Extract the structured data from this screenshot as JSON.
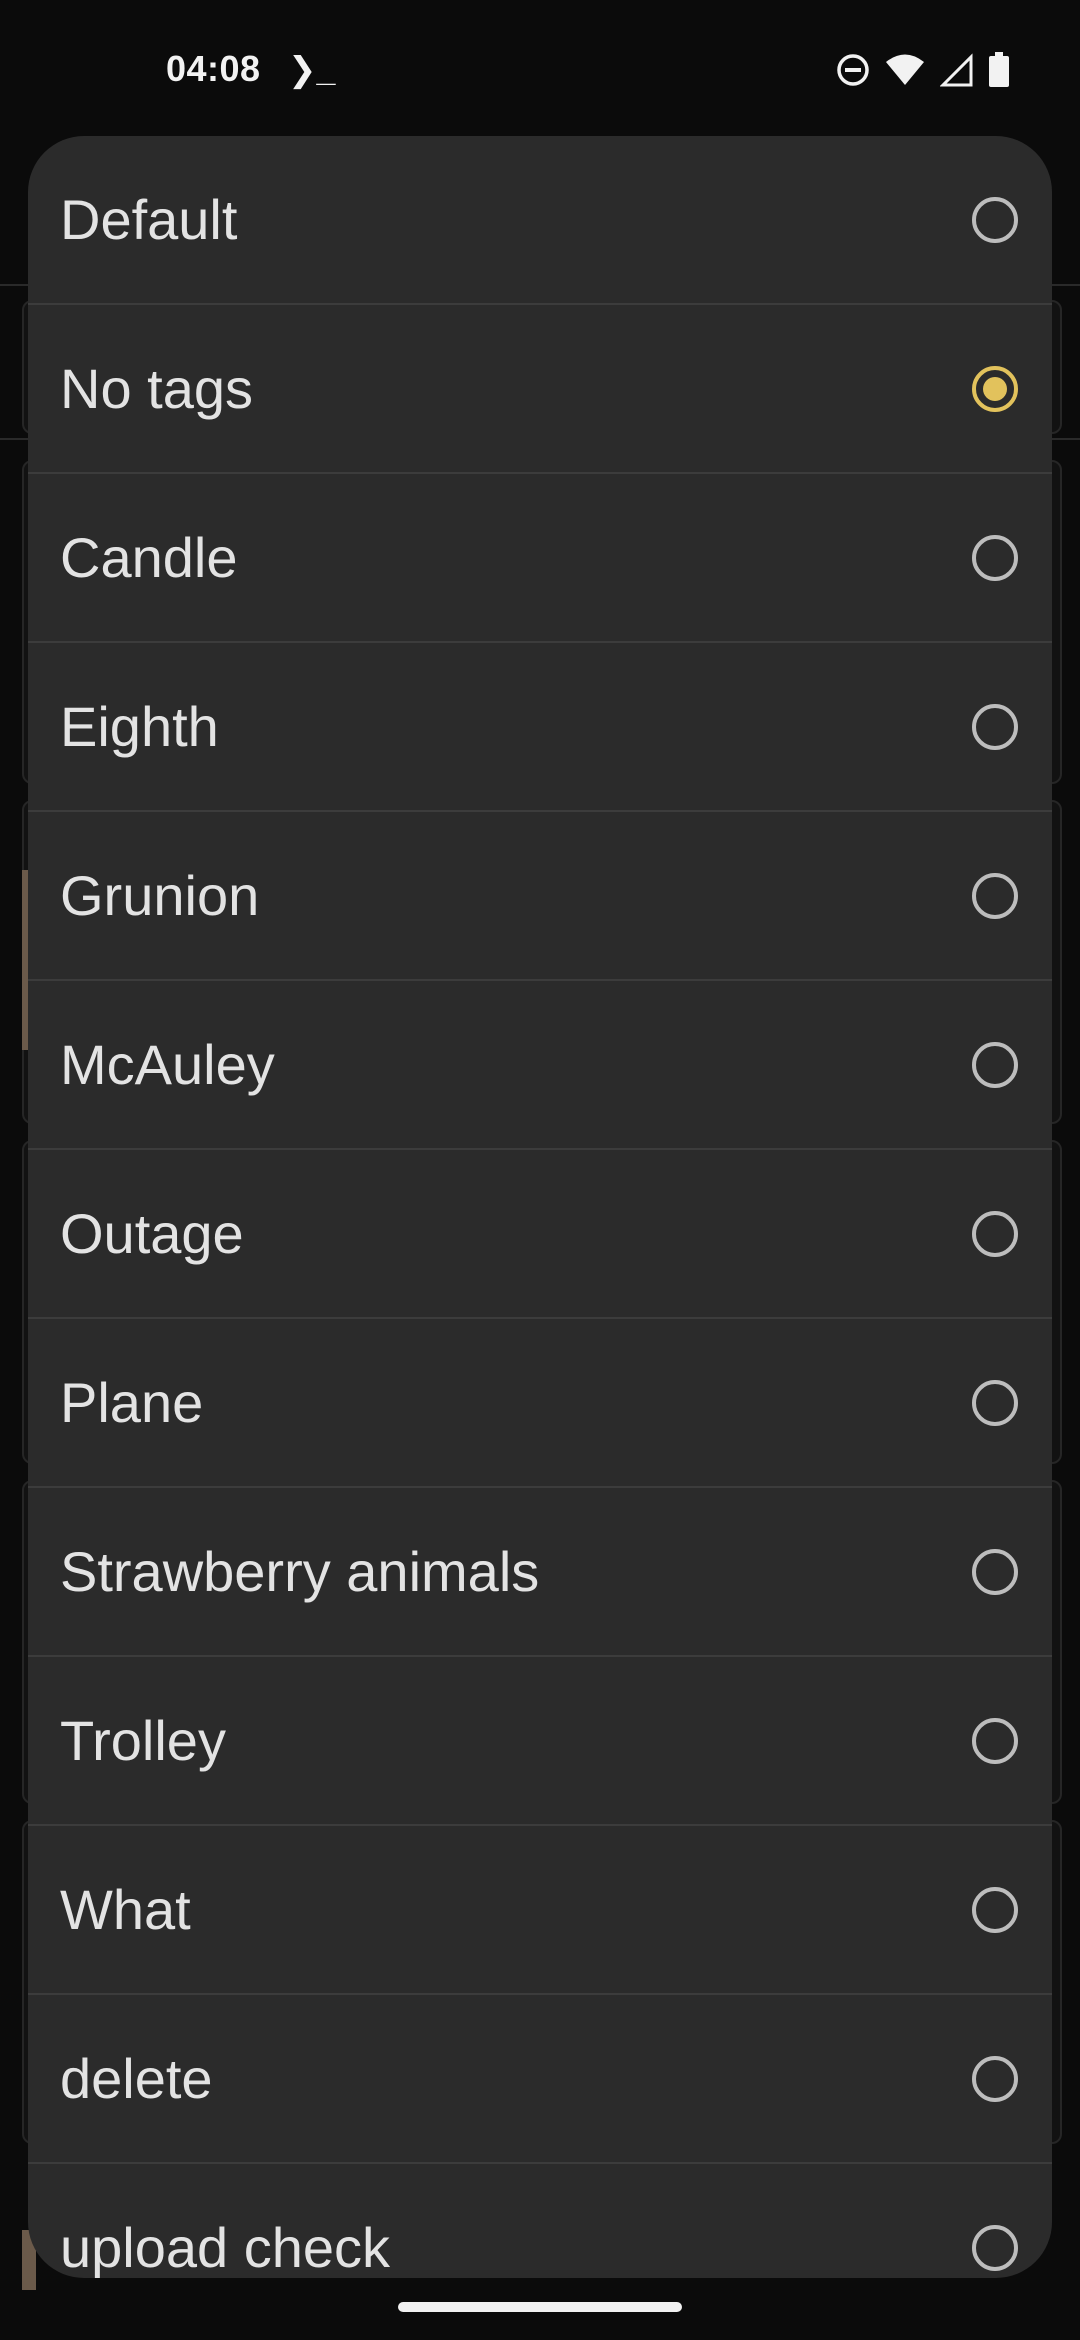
{
  "status_bar": {
    "time": "04:08",
    "icons": [
      "terminal-icon",
      "do-not-disturb-icon",
      "wifi-icon",
      "signal-icon",
      "battery-icon"
    ]
  },
  "dialog": {
    "accent_color": "#e2c25c",
    "options": [
      {
        "label": "Default",
        "selected": false
      },
      {
        "label": "No tags",
        "selected": true
      },
      {
        "label": "Candle",
        "selected": false
      },
      {
        "label": "Eighth",
        "selected": false
      },
      {
        "label": "Grunion",
        "selected": false
      },
      {
        "label": "McAuley",
        "selected": false
      },
      {
        "label": "Outage",
        "selected": false
      },
      {
        "label": "Plane",
        "selected": false
      },
      {
        "label": "Strawberry animals",
        "selected": false
      },
      {
        "label": "Trolley",
        "selected": false
      },
      {
        "label": "What",
        "selected": false
      },
      {
        "label": "delete",
        "selected": false
      },
      {
        "label": "upload check",
        "selected": false
      }
    ]
  }
}
